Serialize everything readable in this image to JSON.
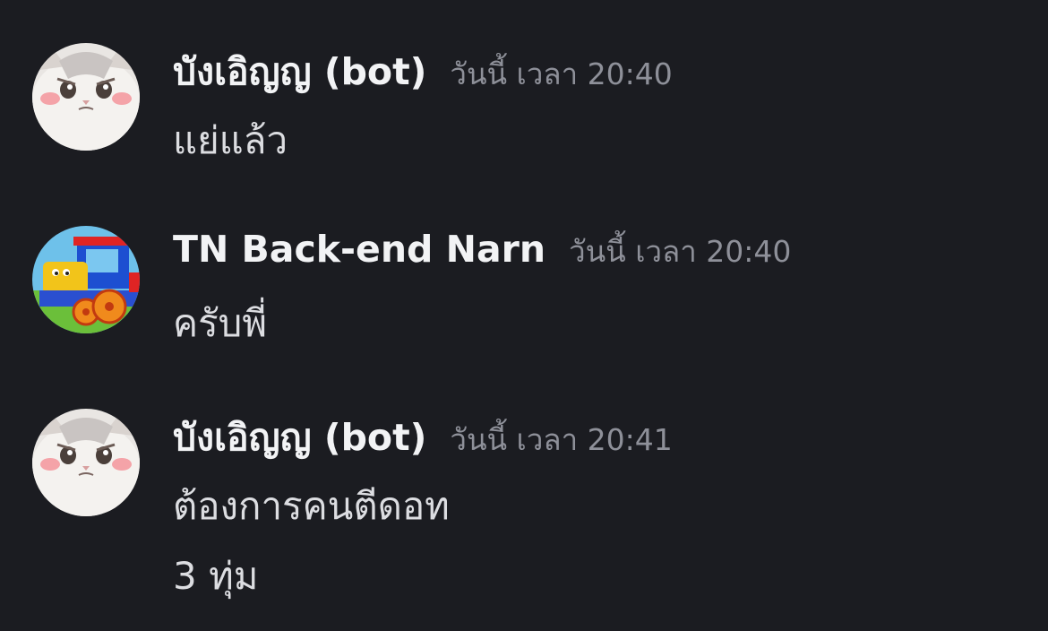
{
  "messages": [
    {
      "author": "บังเอิญญ (bot)",
      "avatar_icon": "white-kitten-avatar",
      "timestamp": "วันนี้ เวลา 20:40",
      "lines": [
        "แย่แล้ว"
      ]
    },
    {
      "author": "TN Back-end Narn",
      "avatar_icon": "toy-train-avatar",
      "timestamp": "วันนี้ เวลา 20:40",
      "lines": [
        "ครับพี่"
      ]
    },
    {
      "author": "บังเอิญญ (bot)",
      "avatar_icon": "white-kitten-avatar",
      "timestamp": "วันนี้ เวลา 20:41",
      "lines": [
        "ต้องการคนตีดอท",
        "3 ทุ่ม"
      ]
    }
  ],
  "colors": {
    "background": "#1b1c21",
    "username": "#f2f3f5",
    "timestamp": "#8e9099",
    "message_text": "#dcdde1"
  }
}
